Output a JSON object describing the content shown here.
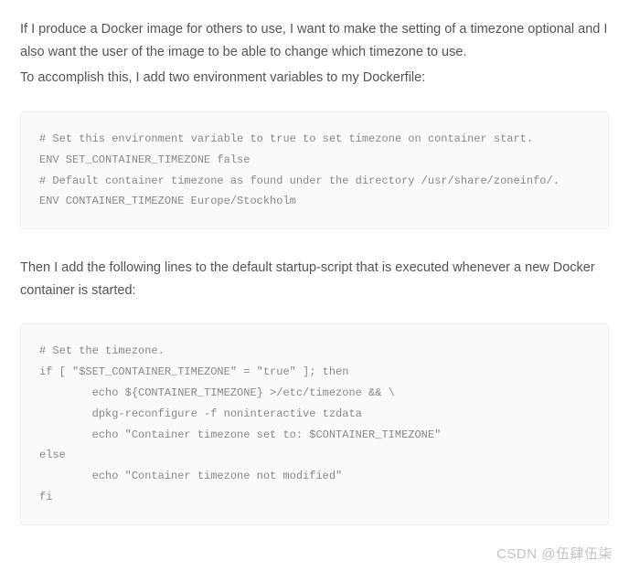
{
  "paragraphs": {
    "p1": "If I produce a Docker image for others to use, I want to make the setting of a timezone optional and I also want the user of the image to be able to change which timezone to use.",
    "p2": "To accomplish this, I add two environment variables to my Dockerfile:",
    "p3": "Then I add the following lines to the default startup-script that is executed whenever a new Docker container is started:"
  },
  "code": {
    "block1": "# Set this environment variable to true to set timezone on container start.\nENV SET_CONTAINER_TIMEZONE false\n# Default container timezone as found under the directory /usr/share/zoneinfo/.\nENV CONTAINER_TIMEZONE Europe/Stockholm",
    "block2": "# Set the timezone.\nif [ \"$SET_CONTAINER_TIMEZONE\" = \"true\" ]; then\n        echo ${CONTAINER_TIMEZONE} >/etc/timezone && \\\n        dpkg-reconfigure -f noninteractive tzdata\n        echo \"Container timezone set to: $CONTAINER_TIMEZONE\"\nelse\n        echo \"Container timezone not modified\"\nfi"
  },
  "watermark": "CSDN @伍肆伍柒"
}
